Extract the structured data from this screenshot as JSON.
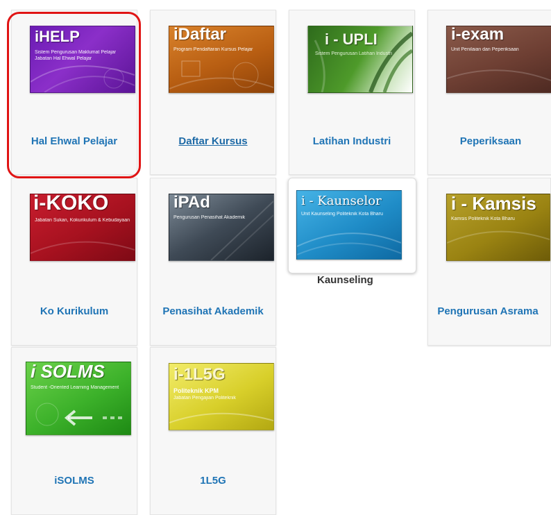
{
  "tiles": [
    {
      "label": "Hal Ehwal Pelajar",
      "banner_title": "iHELP",
      "banner_sub1": "Sistem Pengurusan Maklumat Pelajar",
      "banner_sub2": "Jabatan Hal Ehwal Pelajar"
    },
    {
      "label": "Daftar Kursus",
      "banner_title": "iDaftar",
      "banner_sub1": "Program Pendaftaran Kursus Pelajar"
    },
    {
      "label": "Latihan Industri",
      "banner_title": "i - UPLI",
      "banner_sub1": "Sistem Pengurusan Latihan Industri"
    },
    {
      "label": "Peperiksaan",
      "banner_title": "i-exam",
      "banner_sub1": "Unit Penilaian dan Peperiksaan"
    },
    {
      "label": "Ko Kurikulum",
      "banner_title": "i-KOKO",
      "banner_sub1": "Jabatan Sukan, Kokurikulum & Kebudayaan"
    },
    {
      "label": "Penasihat Akademik",
      "banner_title": "iPAd",
      "banner_sub1": "Pengurusan Penasihat Akademik"
    },
    {
      "label": "Kaunseling",
      "banner_title": "i - Kaunselor",
      "banner_sub1": "Unit Kaunseling Politeknik Kota Bharu"
    },
    {
      "label": "Pengurusan Asrama",
      "banner_title": "i - Kamsis",
      "banner_sub1": "Kamsis Politeknik Kota Bharu"
    },
    {
      "label": "iSOLMS",
      "banner_title": "i SOLMS",
      "banner_sub1": "Student -Oriented Learning Management"
    },
    {
      "label": "1L5G",
      "banner_title": "i-1L5G",
      "banner_sub1": "Politeknik KPM",
      "banner_sub2": "Jabatan Pengajian Politeknik"
    }
  ],
  "colors": {
    "label": "#1f74b5",
    "highlight": "#e01414"
  }
}
